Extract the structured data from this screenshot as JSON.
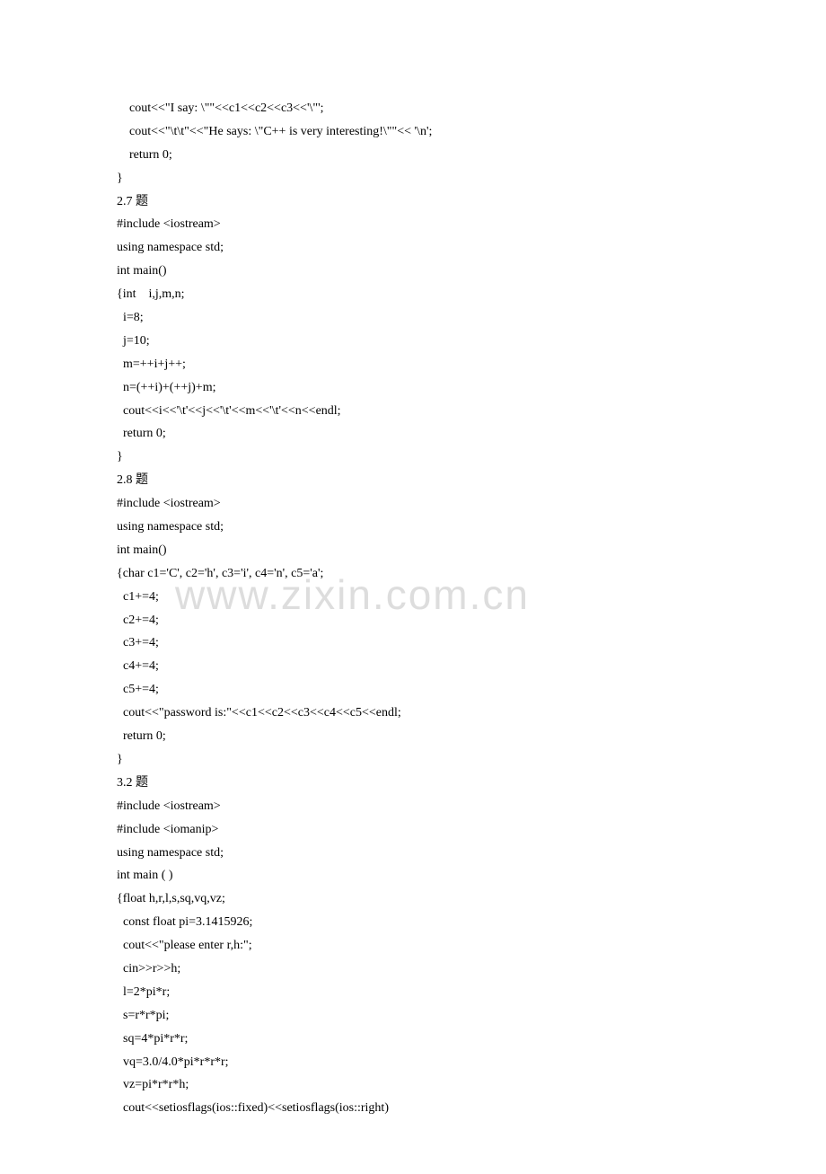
{
  "watermark": "www.zixin.com.cn",
  "lines": [
    "    cout<<\"I say: \\\"\"<<c1<<c2<<c3<<'\\\"';",
    "    cout<<\"\\t\\t\"<<\"He says: \\\"C++ is very interesting!\\\"\"<< '\\n';",
    "    return 0;",
    "}",
    "2.7 题",
    "#include <iostream>",
    "using namespace std;",
    "int main()",
    "{int    i,j,m,n;",
    "  i=8;",
    "  j=10;",
    "  m=++i+j++;",
    "  n=(++i)+(++j)+m;",
    "  cout<<i<<'\\t'<<j<<'\\t'<<m<<'\\t'<<n<<endl;",
    "  return 0;",
    "}",
    "2.8 题",
    "#include <iostream>",
    "using namespace std;",
    "int main()",
    "{char c1='C', c2='h', c3='i', c4='n', c5='a';",
    "  c1+=4;",
    "  c2+=4;",
    "  c3+=4;",
    "  c4+=4;",
    "  c5+=4;",
    "  cout<<\"password is:\"<<c1<<c2<<c3<<c4<<c5<<endl;",
    "  return 0;",
    "}",
    "3.2 题",
    "#include <iostream>",
    "#include <iomanip>",
    "using namespace std;",
    "int main ( )",
    "{float h,r,l,s,sq,vq,vz;",
    "  const float pi=3.1415926;",
    "  cout<<\"please enter r,h:\";",
    "  cin>>r>>h;",
    "  l=2*pi*r;",
    "  s=r*r*pi;",
    "  sq=4*pi*r*r;",
    "  vq=3.0/4.0*pi*r*r*r;",
    "  vz=pi*r*r*h;",
    "  cout<<setiosflags(ios::fixed)<<setiosflags(ios::right)"
  ]
}
